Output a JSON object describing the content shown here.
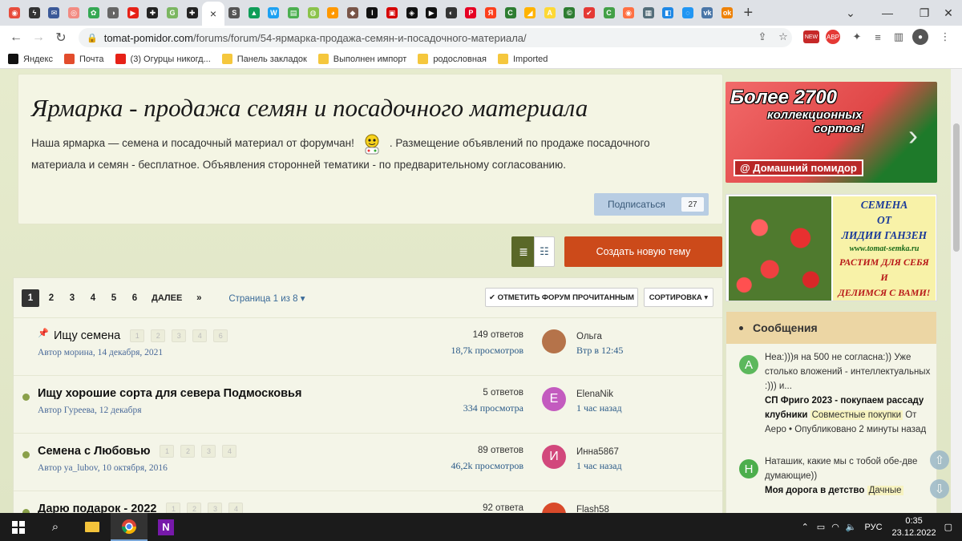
{
  "browser": {
    "url_host": "tomat-pomidor.com",
    "url_path": "/forums/forum/54-ярмарка-продажа-семян-и-посадочного-материала/",
    "tab_close": "×",
    "new_tab": "+",
    "favicons": [
      {
        "color": "#e74c3c",
        "glyph": "◉"
      },
      {
        "color": "#333",
        "glyph": "ϟ"
      },
      {
        "color": "#3b5998",
        "glyph": "✉"
      },
      {
        "color": "#f28b82",
        "glyph": "◎"
      },
      {
        "color": "#34a853",
        "glyph": "✿"
      },
      {
        "color": "#666",
        "glyph": "◑"
      },
      {
        "color": "#e62117",
        "glyph": "▶"
      },
      {
        "color": "#222",
        "glyph": "✚"
      },
      {
        "color": "#7bb661",
        "glyph": "G"
      },
      {
        "color": "#222",
        "glyph": "✚"
      },
      {
        "color": "#555",
        "glyph": "S"
      },
      {
        "color": "#0f9d58",
        "glyph": "▲"
      },
      {
        "color": "#1da1f2",
        "glyph": "W"
      },
      {
        "color": "#4caf50",
        "glyph": "▤"
      },
      {
        "color": "#8bc34a",
        "glyph": "◍"
      },
      {
        "color": "#ff9800",
        "glyph": "◕"
      },
      {
        "color": "#795548",
        "glyph": "◆"
      },
      {
        "color": "#111",
        "glyph": "I"
      },
      {
        "color": "#d50000",
        "glyph": "▣"
      },
      {
        "color": "#111",
        "glyph": "◈"
      },
      {
        "color": "#111",
        "glyph": "▶"
      },
      {
        "color": "#333",
        "glyph": "◐"
      },
      {
        "color": "#e60023",
        "glyph": "P"
      },
      {
        "color": "#fc3f1d",
        "glyph": "Я"
      },
      {
        "color": "#2e7d32",
        "glyph": "C"
      },
      {
        "color": "#ffb300",
        "glyph": "◢"
      },
      {
        "color": "#fdd835",
        "glyph": "A"
      },
      {
        "color": "#2e7d32",
        "glyph": "©"
      },
      {
        "color": "#e53935",
        "glyph": "✔"
      },
      {
        "color": "#43a047",
        "glyph": "C"
      },
      {
        "color": "#ff7043",
        "glyph": "◉"
      },
      {
        "color": "#546e7a",
        "glyph": "▦"
      },
      {
        "color": "#1e88e5",
        "glyph": "◧"
      },
      {
        "color": "#2196f3",
        "glyph": "◌"
      },
      {
        "color": "#4a76a8",
        "glyph": "vk"
      },
      {
        "color": "#ee8208",
        "glyph": "ok"
      }
    ]
  },
  "bookmarks": [
    {
      "label": "Яндекс",
      "icon": "yandex-icon",
      "color": "#111"
    },
    {
      "label": "Почта",
      "icon": "mail-icon",
      "color": "#e24c2c"
    },
    {
      "label": "(3) Огурцы никогд...",
      "icon": "youtube-icon",
      "color": "#e62117"
    },
    {
      "label": "Панель закладок",
      "icon": "folder-icon",
      "color": "#f5c73d"
    },
    {
      "label": "Выполнен импорт",
      "icon": "folder-icon",
      "color": "#f5c73d"
    },
    {
      "label": "родословная",
      "icon": "folder-icon",
      "color": "#f5c73d"
    },
    {
      "label": "Imported",
      "icon": "folder-icon",
      "color": "#f5c73d"
    }
  ],
  "forum": {
    "title": "Ярмарка - продажа семян и посадочного материала",
    "desc_part1": "Наша ярмарка — семена и посадочный материал от форумчан!",
    "desc_part2": ". Размещение объявлений по продаже посадочного материала и семян - бесплатное. Объявления сторонней тематики - по предварительному согласованию.",
    "subscribe_label": "Подписаться",
    "subscribe_count": "27",
    "new_topic_label": "Создать новую тему"
  },
  "pager": {
    "current": "1",
    "pages": [
      "2",
      "3",
      "4",
      "5",
      "6"
    ],
    "next_label": "ДАЛЕЕ",
    "last_label": "»",
    "page_select": "Страница 1 из 8",
    "mark_read": "✔ ОТМЕТИТЬ ФОРУМ ПРОЧИТАННЫМ",
    "sort": "СОРТИРОВКА"
  },
  "topics": [
    {
      "title": "Ищу семена",
      "pinned": true,
      "bold": false,
      "minipages": [
        "1",
        "2",
        "3",
        "4",
        "6"
      ],
      "author": "Автор морина, 14 декабря, 2021",
      "replies": "149 ответов",
      "views": "18,7k просмотров",
      "user": "Ольга",
      "time": "Втр в 12:45",
      "avatar_letter": "",
      "avatar_color": "#b5734a"
    },
    {
      "title": "Ищу хорошие сорта для севера Подмосковья",
      "pinned": false,
      "bold": true,
      "minipages": [],
      "author": "Автор Гуреева, 12 декабря",
      "replies": "5 ответов",
      "views": "334 просмотра",
      "user": "ElenaNik",
      "time": "1 час назад",
      "avatar_letter": "E",
      "avatar_color": "#c35bbf"
    },
    {
      "title": "Семена с Любовью",
      "pinned": false,
      "bold": true,
      "minipages": [
        "1",
        "2",
        "3",
        "4"
      ],
      "author": "Автор ya_lubov, 10 октября, 2016",
      "replies": "89 ответов",
      "views": "46,2k просмотров",
      "user": "Инна5867",
      "time": "1 час назад",
      "avatar_letter": "И",
      "avatar_color": "#d2487c"
    },
    {
      "title": "Дарю подарок - 2022",
      "pinned": false,
      "bold": true,
      "minipages": [
        "1",
        "2",
        "3",
        "4"
      ],
      "author": "",
      "replies": "92 ответа",
      "views": "",
      "user": "Flash58",
      "time": "",
      "avatar_letter": "",
      "avatar_color": "#d94a2a"
    }
  ],
  "ad1": {
    "line1": "Более 2700",
    "line2": "коллекционных",
    "line3": "сортов!",
    "tag": "@ Домашний помидор"
  },
  "ad2": {
    "l1": "СЕМЕНА",
    "l2": "ОТ",
    "l3": "ЛИДИИ ГАНЗЕН",
    "site": "www.tomat-semka.ru",
    "s1": "РАСТИМ ДЛЯ СЕБЯ",
    "s2": "И",
    "s3": "ДЕЛИМСЯ С ВАМИ!"
  },
  "messages": {
    "heading": "Сообщения",
    "items": [
      {
        "letter": "А",
        "color": "#5cb85c",
        "text": "Неа:)))я  на 500 не согласна:)) Уже столько вложений - интеллектуальных  :))) и...",
        "topic": "СП Фриго 2023 - покупаем рассаду клубники",
        "forum": "Совместные покупки",
        "meta": "От Аеро • Опубликовано 2 минуты назад"
      },
      {
        "letter": "Н",
        "color": "#4cae4c",
        "text": "Наташик, какие мы с тобой обе-две думающие))",
        "topic": "Моя дорога в детство",
        "forum": "Дачные",
        "meta": ""
      }
    ]
  },
  "taskbar": {
    "lang": "РУС",
    "time": "0:35",
    "date": "23.12.2022"
  }
}
